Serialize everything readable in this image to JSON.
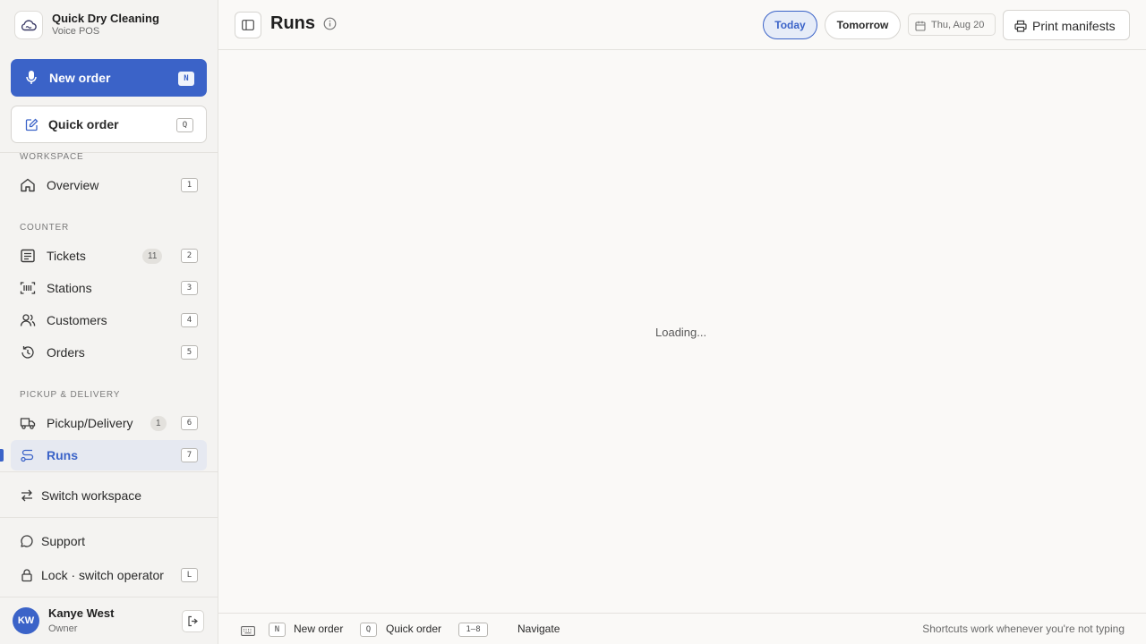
{
  "brand": {
    "name": "Quick Dry Cleaning",
    "subtitle": "Voice POS"
  },
  "actions": {
    "new_order": {
      "label": "New order",
      "shortcut": "N"
    },
    "quick_order": {
      "label": "Quick order",
      "shortcut": "Q"
    }
  },
  "sidebar": {
    "sections": [
      {
        "label": "WORKSPACE",
        "items": [
          {
            "label": "Overview",
            "shortcut": "1",
            "icon": "home-icon"
          }
        ]
      },
      {
        "label": "COUNTER",
        "items": [
          {
            "label": "Tickets",
            "count": "11",
            "shortcut": "2",
            "icon": "tickets-icon"
          },
          {
            "label": "Stations",
            "shortcut": "3",
            "icon": "barcode-icon"
          },
          {
            "label": "Customers",
            "shortcut": "4",
            "icon": "users-icon"
          },
          {
            "label": "Orders",
            "shortcut": "5",
            "icon": "history-icon"
          }
        ]
      },
      {
        "label": "PICKUP & DELIVERY",
        "items": [
          {
            "label": "Pickup/Delivery",
            "count": "1",
            "shortcut": "6",
            "icon": "truck-icon"
          },
          {
            "label": "Runs",
            "shortcut": "7",
            "icon": "route-icon",
            "active": true
          }
        ]
      }
    ],
    "switch_workspace": "Switch workspace",
    "support": "Support",
    "lock": {
      "label": "Lock · switch operator",
      "shortcut": "L"
    },
    "user": {
      "initials": "KW",
      "name": "Kanye West",
      "role": "Owner"
    }
  },
  "header": {
    "title": "Runs",
    "tabs": [
      {
        "label": "Today",
        "selected": true
      },
      {
        "label": "Tomorrow",
        "selected": false
      }
    ],
    "date": "Thu, Aug 20",
    "print_label": "Print manifests"
  },
  "main": {
    "status": "Loading..."
  },
  "footer": {
    "shortcuts": [
      {
        "key": "N",
        "label": "New order"
      },
      {
        "key": "Q",
        "label": "Quick order"
      },
      {
        "key": "1–8",
        "label": "Navigate"
      }
    ],
    "hint": "Shortcuts work whenever you're not typing"
  },
  "colors": {
    "accent": "#3b63c8",
    "sidebar_bg": "#f4f3f1",
    "page_bg": "#faf9f7"
  }
}
